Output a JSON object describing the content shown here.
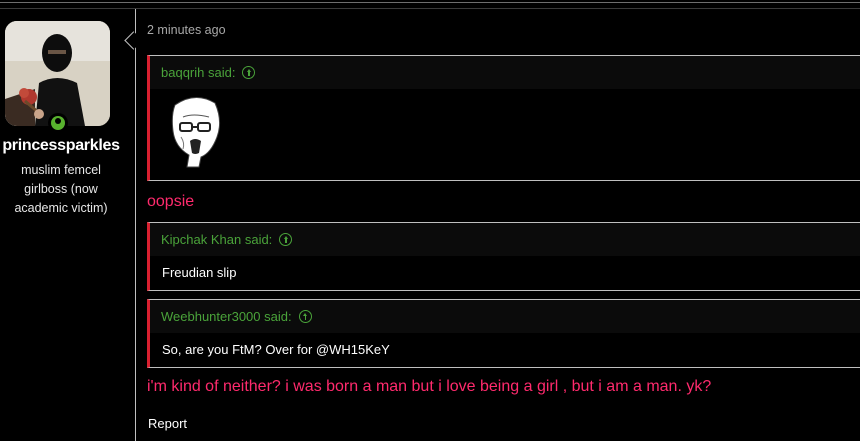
{
  "user": {
    "avatar_icon": "user-avatar-photo",
    "online_status_icon": "online-dot-icon",
    "username": "princessparkles",
    "title": "muslim femcel girlboss (now academic victim)"
  },
  "post": {
    "timestamp": "2 minutes ago",
    "quotes": [
      {
        "author_said": "baqqrih said:",
        "icon": "arrow-up-circle-icon",
        "image_icon": "wojak-meme-image"
      },
      {
        "author_said": "Kipchak Khan said:",
        "icon": "arrow-up-circle-icon",
        "text": "Freudian slip"
      },
      {
        "author_said": "Weebhunter3000 said:",
        "icon": "arrow-up-circle-icon",
        "text": "So, are you FtM? Over for @WH15KeY"
      }
    ],
    "replies": [
      "oopsie",
      "i'm kind of neither? i was born a man but i love being a girl , but i am a man. yk?"
    ],
    "report_label": "Report"
  },
  "colors": {
    "background": "#000000",
    "quote_accent": "#d92030",
    "quote_author": "#4aa33a",
    "reply_text": "#ff2a6d",
    "online": "#58b22e"
  }
}
